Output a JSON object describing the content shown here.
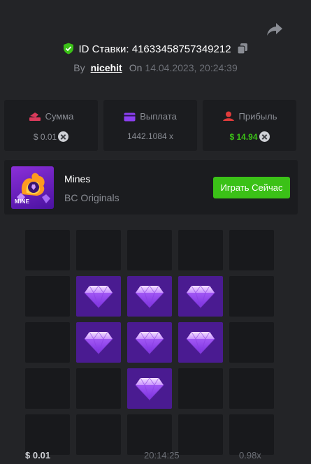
{
  "bet": {
    "id_label": "ID Ставки: 41633458757349212",
    "by_label": "By",
    "user": "nicehit",
    "on_label": "On",
    "date": "14.04.2023, 20:24:39"
  },
  "stats": {
    "amount": {
      "label": "Сумма",
      "value": "$ 0.01",
      "icon": "money-icon"
    },
    "payout": {
      "label": "Выплата",
      "value": "1442.1084 x",
      "icon": "wallet-icon"
    },
    "profit": {
      "label": "Прибыль",
      "value": "$ 14.94",
      "icon": "profit-icon"
    }
  },
  "game": {
    "name": "Mines",
    "provider": "BC Originals",
    "thumb_label": "MINE",
    "play_label": "Играть Сейчас"
  },
  "board": {
    "columns": 5,
    "cells": [
      "empty",
      "empty",
      "empty",
      "empty",
      "empty",
      "empty",
      "gem",
      "gem",
      "gem",
      "empty",
      "empty",
      "gem",
      "gem",
      "gem",
      "empty",
      "empty",
      "empty",
      "gem",
      "empty",
      "empty",
      "empty",
      "empty",
      "empty",
      "empty",
      "empty"
    ]
  },
  "history_row": [
    "$ 0.01",
    "20:14:25",
    "0.98x"
  ],
  "colors": {
    "background": "#232427",
    "panel": "#1b1c1f",
    "cell": "#18191c",
    "gem_cell": "#4a1b91",
    "accent_green": "#3bc117",
    "amount_icon": "#d93a5b",
    "payout_icon": "#8c3ff0",
    "profit_icon": "#e03b3b"
  }
}
